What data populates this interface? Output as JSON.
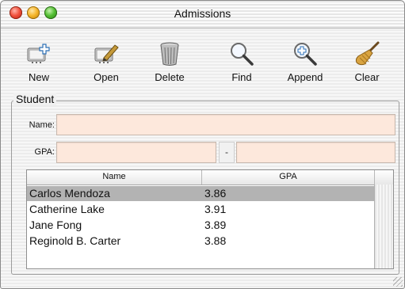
{
  "window": {
    "title": "Admissions"
  },
  "toolbar": {
    "new_label": "New",
    "open_label": "Open",
    "delete_label": "Delete",
    "find_label": "Find",
    "append_label": "Append",
    "clear_label": "Clear"
  },
  "student": {
    "group_title": "Student",
    "name_label": "Name:",
    "gpa_label": "GPA:",
    "name_value": "",
    "gpa_low_value": "",
    "separator": "-",
    "gpa_high_value": ""
  },
  "table": {
    "columns": [
      "Name",
      "GPA"
    ],
    "rows": [
      {
        "name": "Carlos Mendoza",
        "gpa": "3.86",
        "selected": true
      },
      {
        "name": "Catherine Lake",
        "gpa": "3.91",
        "selected": false
      },
      {
        "name": "Jane Fong",
        "gpa": "3.89",
        "selected": false
      },
      {
        "name": "Reginold B. Carter",
        "gpa": "3.88",
        "selected": false
      }
    ]
  },
  "colors": {
    "field_background": "#fde8dc",
    "selected_row": "#b3b3b3"
  },
  "icons": {
    "new": "new-record-icon",
    "open": "edit-record-icon",
    "delete": "trash-icon",
    "find": "magnifier-icon",
    "append": "magnifier-plus-icon",
    "clear": "broom-icon"
  }
}
